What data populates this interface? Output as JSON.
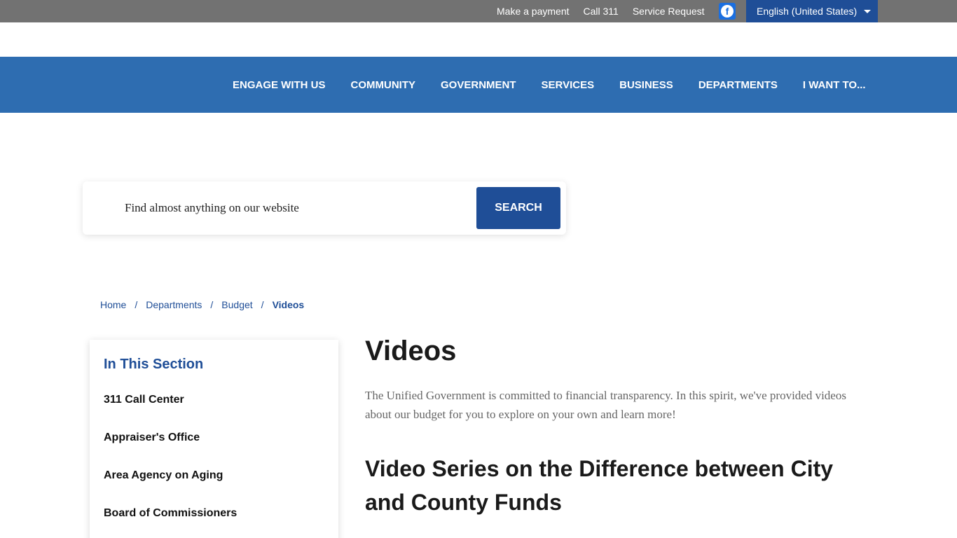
{
  "utility": {
    "links": [
      "Make a payment",
      "Call 311",
      "Service Request"
    ],
    "facebook_icon": "facebook-icon",
    "language": "English (United States)"
  },
  "nav": {
    "items": [
      "ENGAGE WITH US",
      "COMMUNITY",
      "GOVERNMENT",
      "SERVICES",
      "BUSINESS",
      "DEPARTMENTS",
      "I WANT TO..."
    ]
  },
  "search": {
    "placeholder": "Find almost anything on our website",
    "button_label": "SEARCH"
  },
  "breadcrumb": {
    "items": [
      "Home",
      "Departments",
      "Budget"
    ],
    "current": "Videos",
    "separator": "/"
  },
  "sidebar": {
    "title": "In This Section",
    "items": [
      "311 Call Center",
      "Appraiser's Office",
      "Area Agency on Aging",
      "Board of Commissioners"
    ]
  },
  "main": {
    "title": "Videos",
    "intro": "The Unified Government is committed to financial transparency. In this spirit, we've provided videos about our budget for you to explore on your own and learn more!",
    "section_heading": "Video Series on the Difference between City and County Funds"
  },
  "colors": {
    "utility_bar": "#727272",
    "nav_bar": "#2e6db1",
    "accent": "#1f4e97"
  }
}
